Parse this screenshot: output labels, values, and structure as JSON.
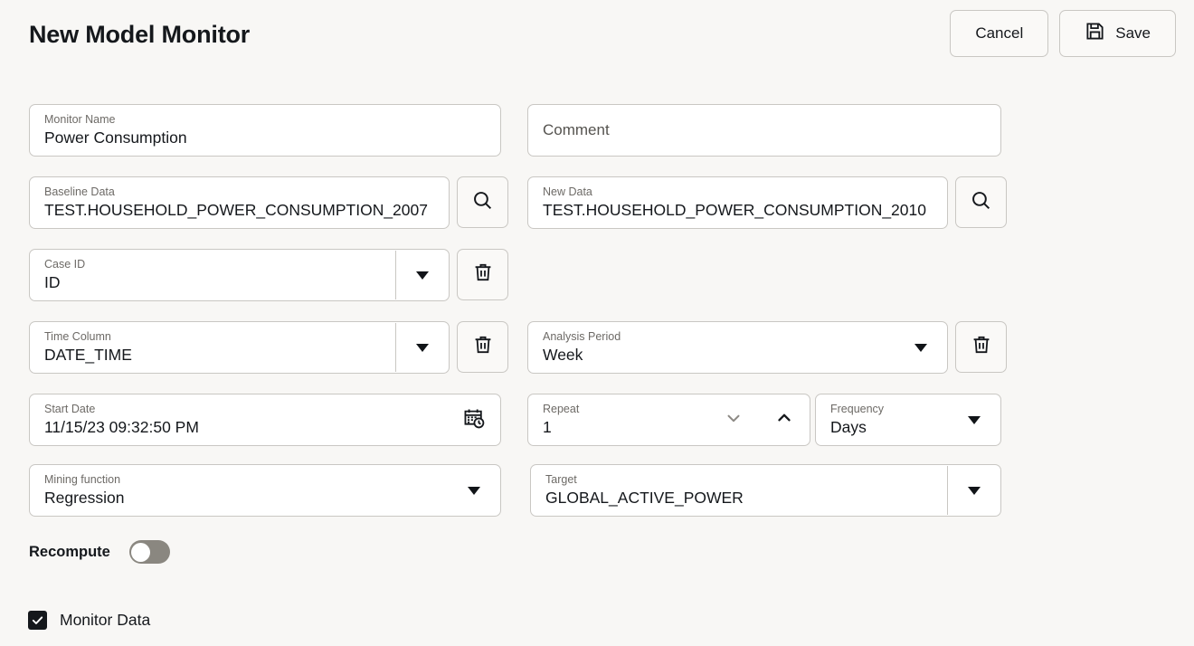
{
  "header": {
    "title": "New Model Monitor",
    "cancel_label": "Cancel",
    "save_label": "Save",
    "save_icon": "save-floppy-icon"
  },
  "form": {
    "monitor_name": {
      "label": "Monitor Name",
      "value": "Power Consumption"
    },
    "comment": {
      "placeholder": "Comment",
      "value": ""
    },
    "baseline_data": {
      "label": "Baseline Data",
      "value": "TEST.HOUSEHOLD_POWER_CONSUMPTION_2007",
      "action_icon": "search-icon"
    },
    "new_data": {
      "label": "New Data",
      "value": "TEST.HOUSEHOLD_POWER_CONSUMPTION_2010",
      "action_icon": "search-icon"
    },
    "case_id": {
      "label": "Case ID",
      "value": "ID",
      "action_icon": "trash-icon"
    },
    "time_column": {
      "label": "Time Column",
      "value": "DATE_TIME",
      "action_icon": "trash-icon"
    },
    "analysis_period": {
      "label": "Analysis Period",
      "value": "Week",
      "action_icon": "trash-icon"
    },
    "start_date": {
      "label": "Start Date",
      "value": "11/15/23 09:32:50 PM",
      "icon": "calendar-clock-icon"
    },
    "repeat": {
      "label": "Repeat",
      "value": "1",
      "down_icon": "chevron-down-icon",
      "up_icon": "chevron-up-icon"
    },
    "frequency": {
      "label": "Frequency",
      "value": "Days"
    },
    "mining_function": {
      "label": "Mining function",
      "value": "Regression"
    },
    "target": {
      "label": "Target",
      "value": "GLOBAL_ACTIVE_POWER"
    },
    "recompute": {
      "label": "Recompute",
      "state": "off"
    },
    "monitor_data": {
      "label": "Monitor Data",
      "checked": true
    }
  },
  "colors": {
    "page_background": "#f8f7f5",
    "field_background": "#ffffff",
    "border": "#c9c7c3",
    "text": "#15181c",
    "label_text": "#6d6a66",
    "toggle_off_track": "#8a8780"
  }
}
